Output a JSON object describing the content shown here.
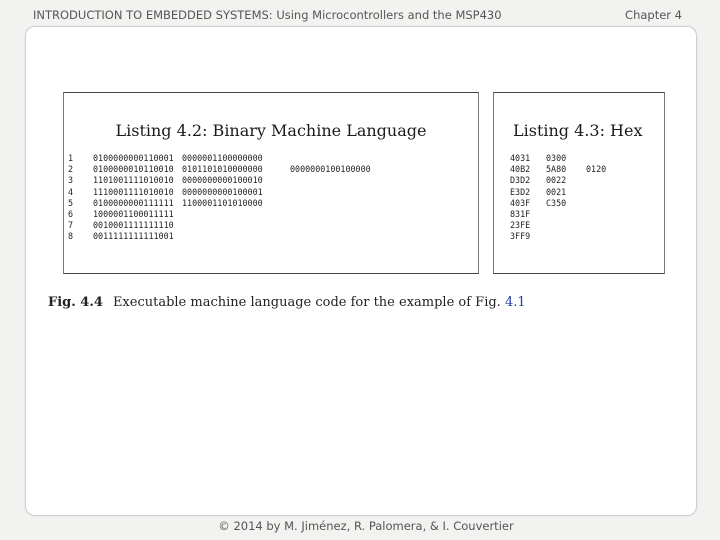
{
  "header": {
    "title": "INTRODUCTION TO EMBEDDED SYSTEMS: Using Microcontrollers and the MSP430",
    "chapter": "Chapter 4"
  },
  "listing_binary": {
    "title": "Listing 4.2: Binary Machine Language",
    "rows": [
      {
        "n": "1",
        "c1": "0100000000110001",
        "c2": "0000001100000000",
        "c3": ""
      },
      {
        "n": "2",
        "c1": "0100000010110010",
        "c2": "0101101010000000",
        "c3": "0000000100100000"
      },
      {
        "n": "3",
        "c1": "1101001111010010",
        "c2": "0000000000100010",
        "c3": ""
      },
      {
        "n": "4",
        "c1": "1110001111010010",
        "c2": "0000000000100001",
        "c3": ""
      },
      {
        "n": "5",
        "c1": "0100000000111111",
        "c2": "1100001101010000",
        "c3": ""
      },
      {
        "n": "6",
        "c1": "1000001100011111",
        "c2": "",
        "c3": ""
      },
      {
        "n": "7",
        "c1": "0010001111111110",
        "c2": "",
        "c3": ""
      },
      {
        "n": "8",
        "c1": "0011111111111001",
        "c2": "",
        "c3": ""
      }
    ]
  },
  "listing_hex": {
    "title": "Listing 4.3: Hex",
    "rows": [
      {
        "c1": "4031",
        "c2": "0300",
        "c3": ""
      },
      {
        "c1": "40B2",
        "c2": "5A80",
        "c3": "0120"
      },
      {
        "c1": "D3D2",
        "c2": "0022",
        "c3": ""
      },
      {
        "c1": "E3D2",
        "c2": "0021",
        "c3": ""
      },
      {
        "c1": "403F",
        "c2": "C350",
        "c3": ""
      },
      {
        "c1": "831F",
        "c2": "",
        "c3": ""
      },
      {
        "c1": "23FE",
        "c2": "",
        "c3": ""
      },
      {
        "c1": "3FF9",
        "c2": "",
        "c3": ""
      }
    ]
  },
  "caption": {
    "label": "Fig. 4.4",
    "text": "Executable machine language code for the example of Fig.",
    "ref": "4.1"
  },
  "footer": {
    "text": "© 2014 by M. Jiménez, R. Palomera, & I. Couvertier"
  }
}
